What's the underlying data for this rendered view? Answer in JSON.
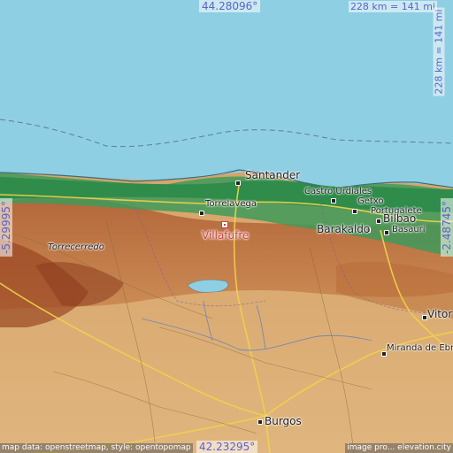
{
  "map": {
    "place_name": "Villafufre",
    "coords": {
      "top": "44.28096°",
      "bottom": "42.23295°",
      "left": "-5.29995°",
      "right": "-2.48745°"
    },
    "scale": {
      "horizontal": "228 km = 141 mi",
      "vertical": "228 km = 141 mi"
    },
    "credits": {
      "left": "map data: openstreetmap, style: opentopomap",
      "right": "image pro... elevation.city"
    },
    "cities": [
      {
        "id": "santander",
        "label": "Santander"
      },
      {
        "id": "castro-urdiales",
        "label": "Castro Urdiales"
      },
      {
        "id": "torrelavega",
        "label": "Torrelavega"
      },
      {
        "id": "getxo",
        "label": "Getxo"
      },
      {
        "id": "portugalete",
        "label": "Portugalete"
      },
      {
        "id": "bilbao",
        "label": "Bilbao"
      },
      {
        "id": "basauri",
        "label": "Basauri"
      },
      {
        "id": "barakaldo",
        "label": "Barakaldo"
      },
      {
        "id": "torrecerredo",
        "label": "Torrecerredo"
      },
      {
        "id": "vitoria",
        "label": "Vitor"
      },
      {
        "id": "miranda-de-ebro",
        "label": "Miranda de Ebro"
      },
      {
        "id": "burgos",
        "label": "Burgos"
      }
    ],
    "colors": {
      "sea": "#8fcfe3",
      "lowland": "#2f9a55",
      "highland": "#b9652f",
      "plateau": "#d8a86c",
      "marker": "#d23e3e",
      "coord_text": "#5b63c8"
    }
  }
}
